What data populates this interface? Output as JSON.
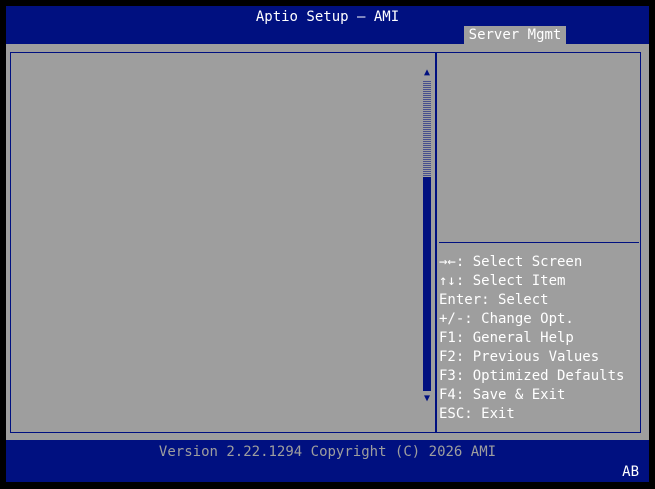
{
  "header": {
    "title": "Aptio Setup – AMI",
    "tabs": [
      {
        "label": "Server Mgmt",
        "active": true
      }
    ]
  },
  "help": {
    "items": [
      {
        "label": "→←: Select Screen"
      },
      {
        "label": "↑↓: Select Item"
      },
      {
        "label": "Enter: Select"
      },
      {
        "label": "+/-: Change Opt."
      },
      {
        "label": "F1: General Help"
      },
      {
        "label": "F2: Previous Values"
      },
      {
        "label": "F3: Optimized Defaults"
      },
      {
        "label": "F4: Save & Exit"
      },
      {
        "label": "ESC: Exit"
      }
    ]
  },
  "scrollbar": {
    "up_glyph": "▲",
    "down_glyph": "▼"
  },
  "footer": {
    "version": "Version 2.22.1294 Copyright (C) 2026 AMI",
    "corner": "AB"
  },
  "colors": {
    "background": "#9e9e9e",
    "accent_blue": "#001080",
    "text_white": "#ffffff",
    "outer_black": "#000000"
  }
}
